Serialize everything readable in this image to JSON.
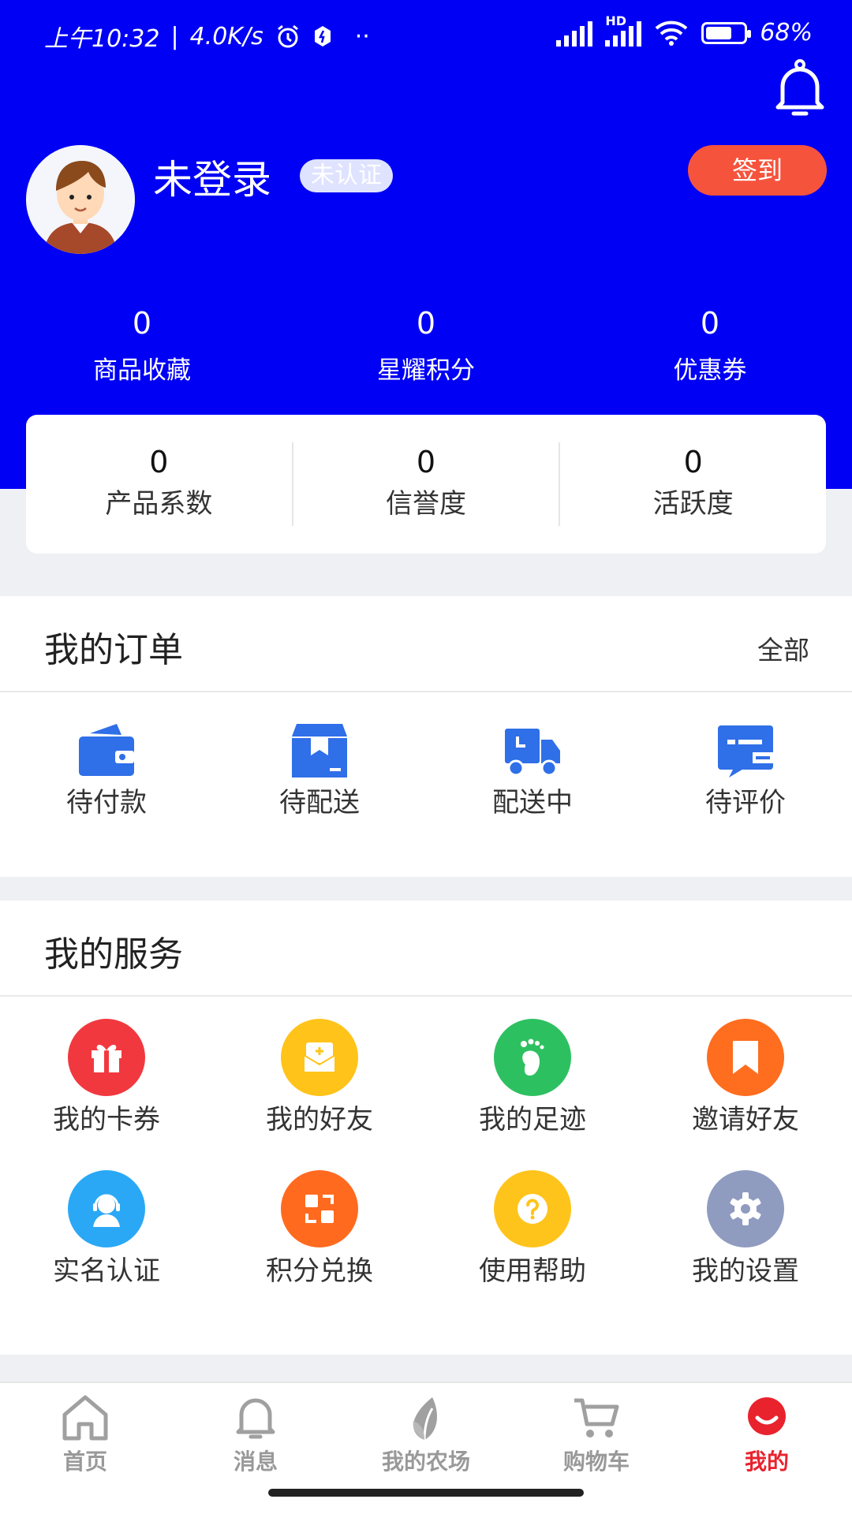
{
  "status_bar": {
    "time": "上午10:32",
    "net_speed": "4.0K/s",
    "extra": "··",
    "network": "HD",
    "battery": "68%"
  },
  "profile": {
    "name": "未登录",
    "cert_badge": "未认证",
    "signin_label": "签到"
  },
  "stats": [
    {
      "value": "0",
      "label": "商品收藏"
    },
    {
      "value": "0",
      "label": "星耀积分"
    },
    {
      "value": "0",
      "label": "优惠券"
    }
  ],
  "credit": [
    {
      "value": "0",
      "label": "产品系数"
    },
    {
      "value": "0",
      "label": "信誉度"
    },
    {
      "value": "0",
      "label": "活跃度"
    }
  ],
  "orders": {
    "title": "我的订单",
    "all_label": "全部",
    "items": [
      {
        "label": "待付款",
        "icon": "wallet-icon"
      },
      {
        "label": "待配送",
        "icon": "package-icon"
      },
      {
        "label": "配送中",
        "icon": "truck-icon"
      },
      {
        "label": "待评价",
        "icon": "review-icon"
      }
    ]
  },
  "services": {
    "title": "我的服务",
    "items": [
      {
        "label": "我的卡券",
        "icon": "gift-icon",
        "color": "#f2383f"
      },
      {
        "label": "我的好友",
        "icon": "envelope-icon",
        "color": "#ffc31a"
      },
      {
        "label": "我的足迹",
        "icon": "footprint-icon",
        "color": "#2dc061"
      },
      {
        "label": "邀请好友",
        "icon": "bookmark-icon",
        "color": "#ff6d1f"
      },
      {
        "label": "实名认证",
        "icon": "user-headset-icon",
        "color": "#2aa8f5"
      },
      {
        "label": "积分兑换",
        "icon": "exchange-icon",
        "color": "#ff6a1f"
      },
      {
        "label": "使用帮助",
        "icon": "help-icon",
        "color": "#ffc41c"
      },
      {
        "label": "我的设置",
        "icon": "gear-icon",
        "color": "#8f9bbf"
      }
    ]
  },
  "tabbar": {
    "items": [
      {
        "label": "首页",
        "icon": "home-icon"
      },
      {
        "label": "消息",
        "icon": "bell-icon"
      },
      {
        "label": "我的农场",
        "icon": "leaf-icon"
      },
      {
        "label": "购物车",
        "icon": "cart-icon"
      },
      {
        "label": "我的",
        "icon": "profile-icon"
      }
    ],
    "active_color": "#e8232e"
  },
  "colors": {
    "header": "#0000f4",
    "signin": "#f6533d",
    "order_icon": "#2f6fe8"
  }
}
